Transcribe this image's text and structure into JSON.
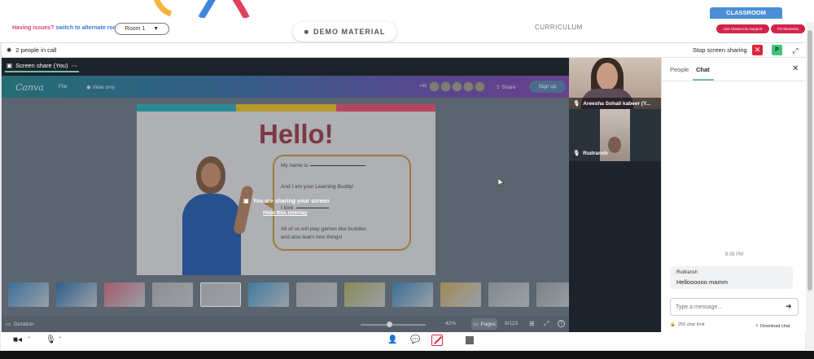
{
  "topbar": {
    "issues_text": "Having issues?",
    "alt_room_link": "switch to alternate room",
    "room_select": "Room 1",
    "demo_tab": "DEMO MATERIAL",
    "curriculum_tab": "CURRICULUM",
    "classroom_tab": "CLASSROOM",
    "live_support": "Live Classroom Support",
    "ps_moments": "PS Moments"
  },
  "call": {
    "people_count": "2 people in call",
    "stop_share": "Stop screen sharing",
    "participant_badge": "P"
  },
  "share": {
    "tab_label": "Screen share (You)",
    "overlay_message": "You are sharing your screen",
    "overlay_hide": "Hide this overlay"
  },
  "canva": {
    "logo": "Canva",
    "file_menu": "File",
    "view_only": "View only",
    "avatar_count": "+65",
    "share": "Share",
    "sign_up": "Sign up",
    "slide": {
      "title": "Hello!",
      "line1": "My name is",
      "line2": "And I am your Learning Buddy!",
      "line3": "I love",
      "line4": "All of us will play games like buddies",
      "line5": "and also learn new things!",
      "stripe_colors": [
        "#2a8a93",
        "#b9992f",
        "#b54660"
      ]
    },
    "duration": "Duration",
    "zoom": "42%",
    "pages_btn": "Pages",
    "page_count": "9/123"
  },
  "tiles": [
    {
      "name": "Areesha Sohail kabeer (Y..."
    },
    {
      "name": "Rudransh"
    }
  ],
  "chat": {
    "tab_people": "People",
    "tab_chat": "Chat",
    "time": "8:08 PM",
    "sender": "Rudransh",
    "message": "Helloooooo mamm",
    "placeholder": "Type a message...",
    "char_limit": "256 char limit",
    "download": "Download chat"
  },
  "colors": {
    "accent_red": "#e0243b",
    "accent_green": "#6fc1a8",
    "classroom_blue": "#4a8fd6"
  }
}
